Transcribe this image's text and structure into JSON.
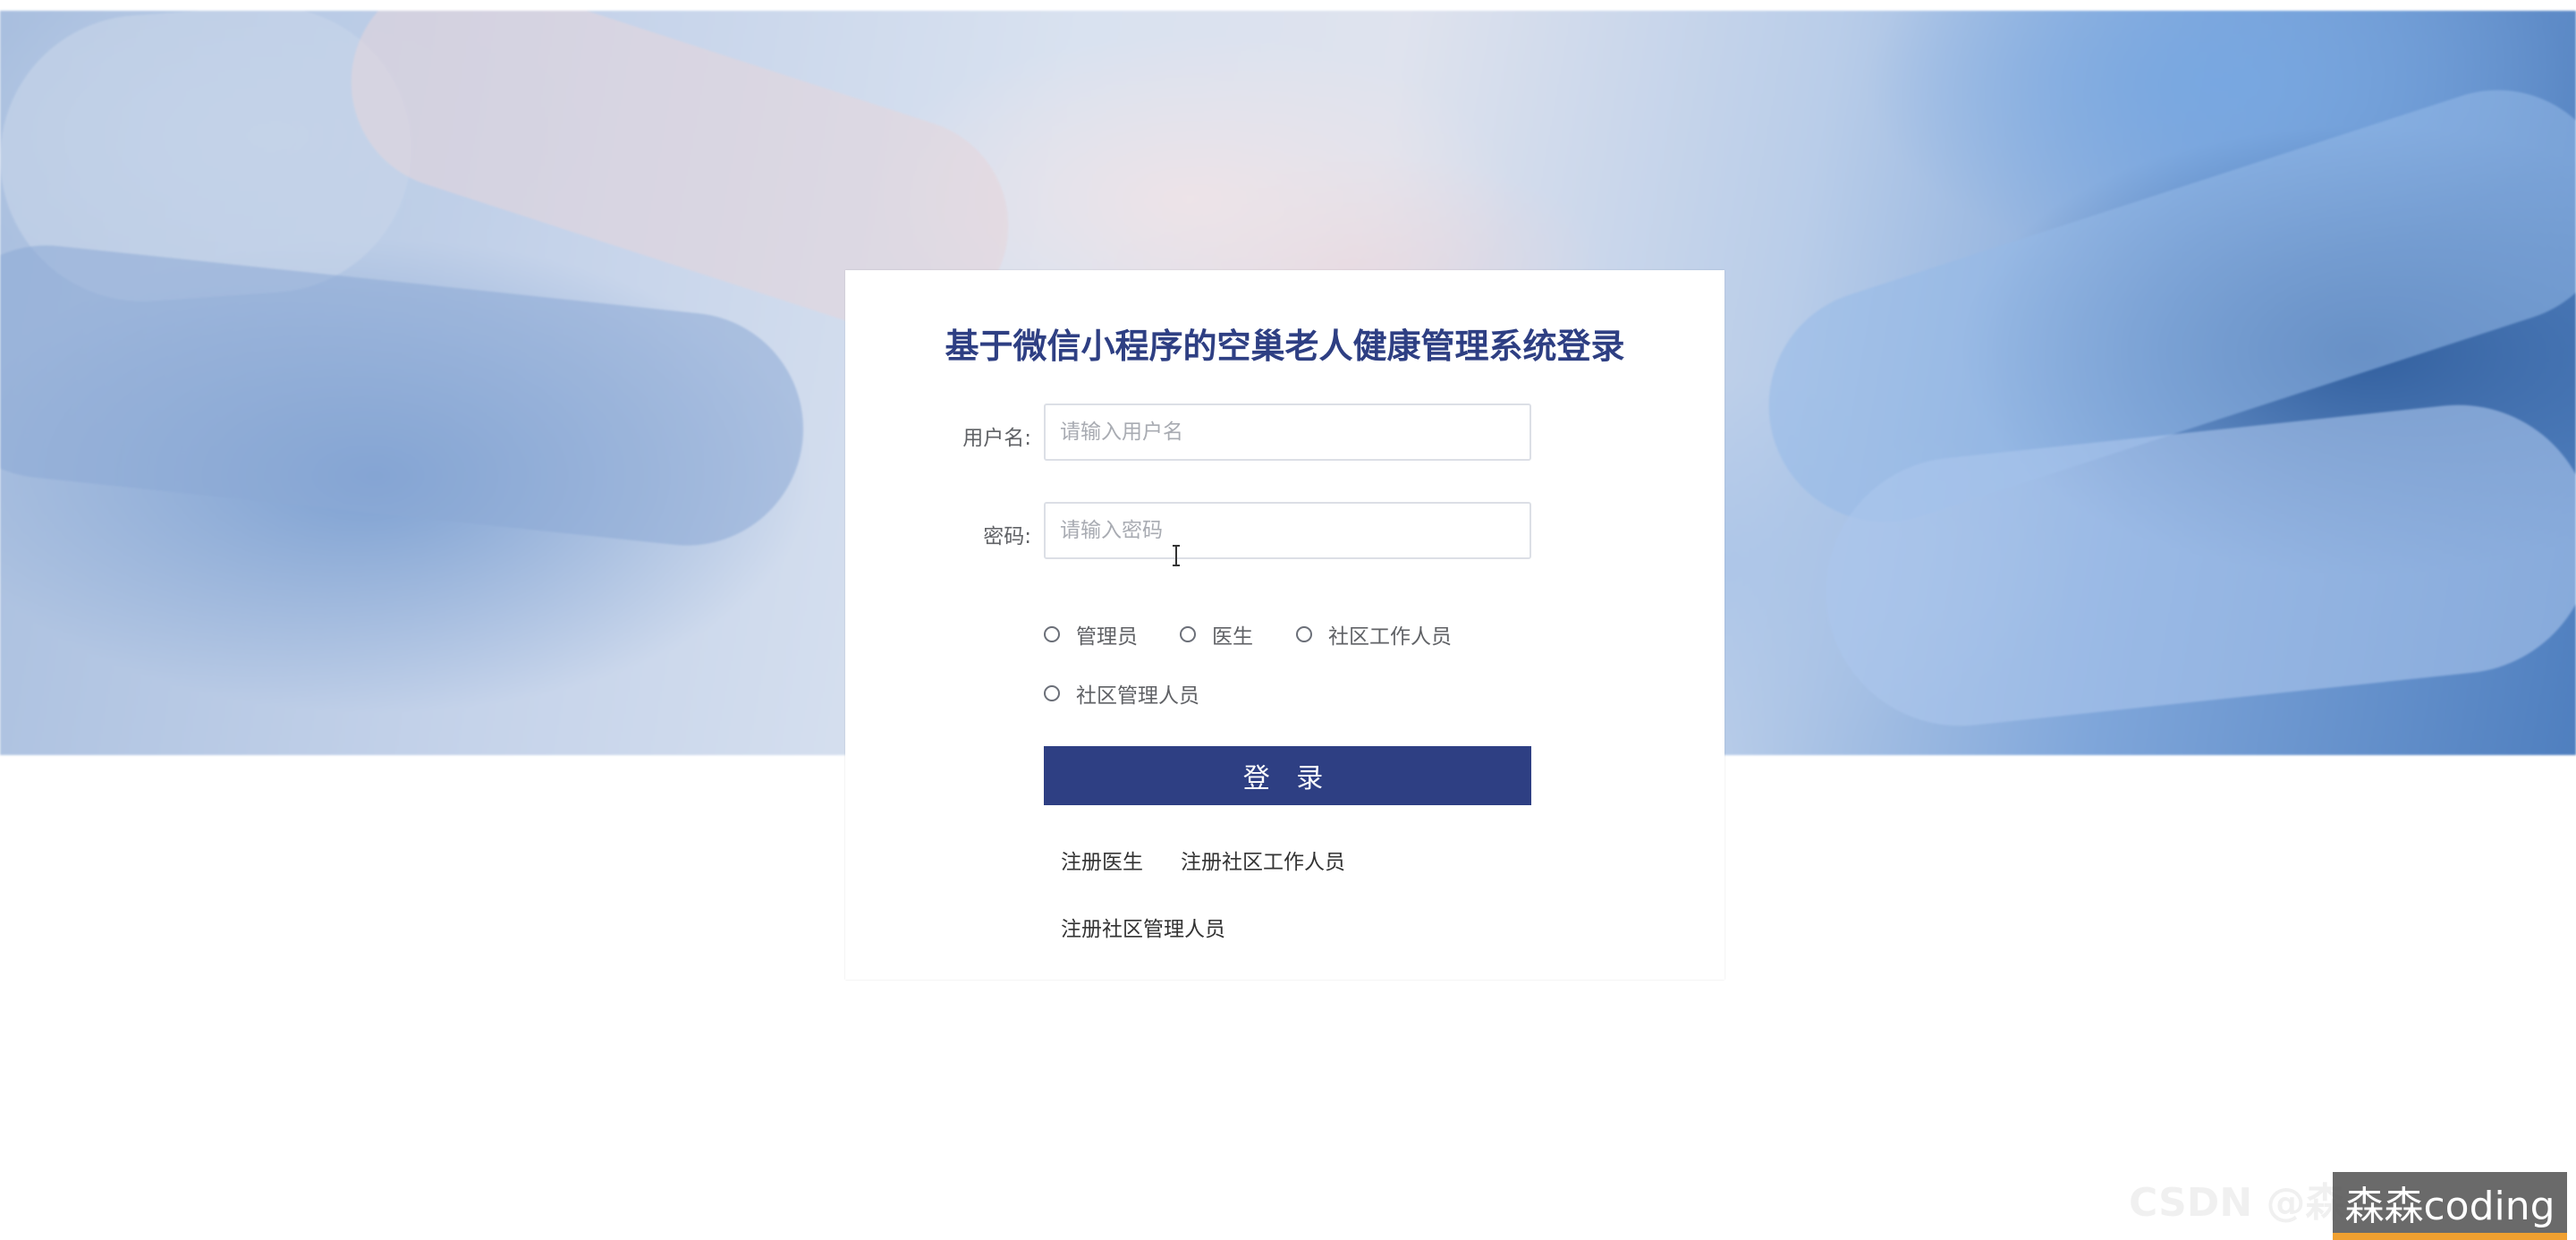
{
  "login_form": {
    "title": "基于微信小程序的空巢老人健康管理系统登录",
    "username_label": "用户名:",
    "username_placeholder": "请输入用户名",
    "username_value": "",
    "password_label": "密码:",
    "password_placeholder": "请输入密码",
    "password_value": "",
    "roles": [
      {
        "label": "管理员",
        "selected": false
      },
      {
        "label": "医生",
        "selected": false
      },
      {
        "label": "社区工作人员",
        "selected": false
      },
      {
        "label": "社区管理人员",
        "selected": false
      }
    ],
    "login_button": "登 录",
    "links": {
      "register_doctor": "注册医生",
      "register_worker": "注册社区工作人员",
      "register_manager": "注册社区管理人员"
    }
  },
  "watermark": {
    "faint_text": "CSDN @森",
    "box_text": "森森coding"
  },
  "colors": {
    "primary": "#2e3f83",
    "label": "#606266",
    "border": "#dcdfe6"
  }
}
